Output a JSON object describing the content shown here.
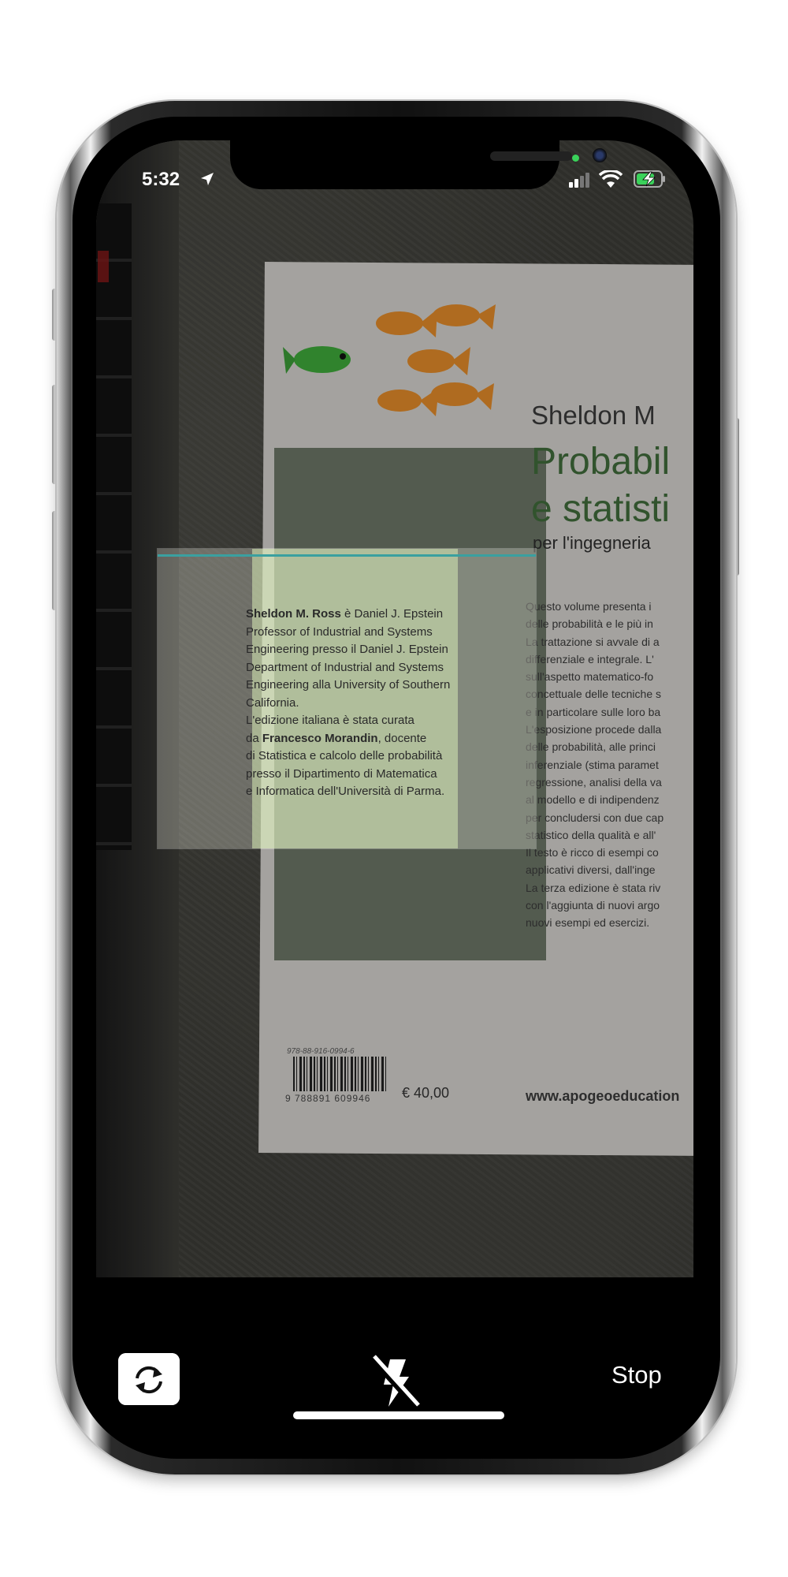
{
  "status_bar": {
    "time": "5:32",
    "location_icon": "location-arrow-icon",
    "signal_icon": "cellular-signal-icon",
    "wifi_icon": "wifi-icon",
    "battery_icon": "battery-charging-icon",
    "camera_in_use_color": "#3ad25a"
  },
  "book": {
    "author": "Sheldon M",
    "title_line1": "Probabil",
    "title_line2": "e statisti",
    "subtitle": "per l'ingegneria",
    "left_column": [
      {
        "bold": "Sheldon M. Ross",
        "text": " è Daniel J. Epstein"
      },
      {
        "bold": "",
        "text": "Professor of Industrial and Systems"
      },
      {
        "bold": "",
        "text": "Engineering presso il Daniel J. Epstein"
      },
      {
        "bold": "",
        "text": "Department of Industrial and Systems"
      },
      {
        "bold": "",
        "text": "Engineering alla University of Southern"
      },
      {
        "bold": "",
        "text": "California."
      },
      {
        "bold": "",
        "text": "L'edizione italiana è stata curata"
      },
      {
        "bold": "Francesco Morandin",
        "pre": "da ",
        "text": ", docente"
      },
      {
        "bold": "",
        "text": "di Statistica e calcolo delle probabilità"
      },
      {
        "bold": "",
        "text": "presso il Dipartimento di Matematica"
      },
      {
        "bold": "",
        "text": "e Informatica dell'Università di Parma."
      }
    ],
    "right_column": [
      "Questo volume presenta i",
      "delle probabilità e le più in",
      "La trattazione si avvale di a",
      "differenziale e integrale. L'",
      "sull'aspetto matematico-fo",
      "concettuale delle tecniche s",
      "e in particolare sulle loro ba",
      "L'esposizione procede dalla",
      "delle probabilità, alle princi",
      "inferenziale (stima paramet",
      "regressione, analisi della va",
      "al modello e di indipendenz",
      "per concludersi con due cap",
      "statistico della qualità e all'",
      "Il testo è ricco di esempi co",
      "applicativi diversi, dall'inge",
      "La terza edizione è stata riv",
      "con l'aggiunta di nuovi argo",
      "nuovi esempi ed esercizi."
    ],
    "isbn_small": "978-88-916-0994-6",
    "barcode_digits": "9 788891 609946",
    "price": "€ 40,00",
    "website": "www.apogeoeducation"
  },
  "colors": {
    "scan_line": "#3aa0a0",
    "title_green": "#3f6b3a"
  },
  "controls": {
    "flip_camera_icon": "camera-rotate-icon",
    "flash_icon": "flash-off-icon",
    "stop_label": "Stop"
  }
}
